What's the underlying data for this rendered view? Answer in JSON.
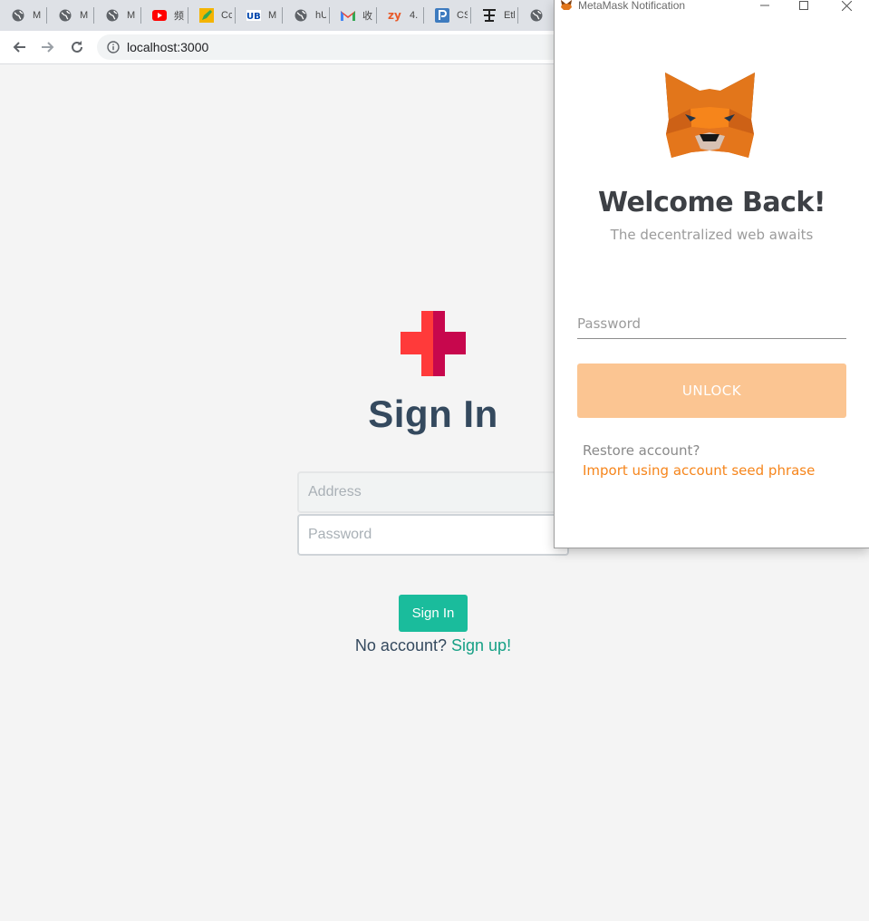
{
  "browser": {
    "tabs": [
      {
        "label": "M",
        "icon": "globe-icon"
      },
      {
        "label": "M",
        "icon": "globe-icon"
      },
      {
        "label": "M",
        "icon": "globe-icon"
      },
      {
        "label": "频",
        "icon": "youtube-icon"
      },
      {
        "label": "Cc",
        "icon": "pencil-icon"
      },
      {
        "label": "M",
        "icon": "ub-icon"
      },
      {
        "label": "hU",
        "icon": "globe-icon"
      },
      {
        "label": "收",
        "icon": "gmail-icon"
      },
      {
        "label": "4.",
        "icon": "zy-icon"
      },
      {
        "label": "CS",
        "icon": "p-icon"
      },
      {
        "label": "Eth",
        "icon": "eth-icon"
      },
      {
        "label": "",
        "icon": "globe-icon"
      }
    ],
    "url": "localhost:3000"
  },
  "page": {
    "title": "Sign In",
    "address_placeholder": "Address",
    "password_placeholder": "Password",
    "signin_button": "Sign In",
    "no_account_text": "No account?",
    "signup_link": "Sign up!",
    "colors": {
      "accent": "#1abc9c",
      "title": "#34495e",
      "logo_left": "#ff3a3a",
      "logo_right": "#c7074d"
    }
  },
  "metamask": {
    "window_title": "MetaMask Notification",
    "welcome": "Welcome Back!",
    "tagline": "The decentralized web awaits",
    "password_placeholder": "Password",
    "unlock_button": "UNLOCK",
    "restore_text": "Restore account?",
    "import_link": "Import using account seed phrase",
    "colors": {
      "unlock_bg": "#fbc592",
      "link": "#f6851b"
    }
  }
}
